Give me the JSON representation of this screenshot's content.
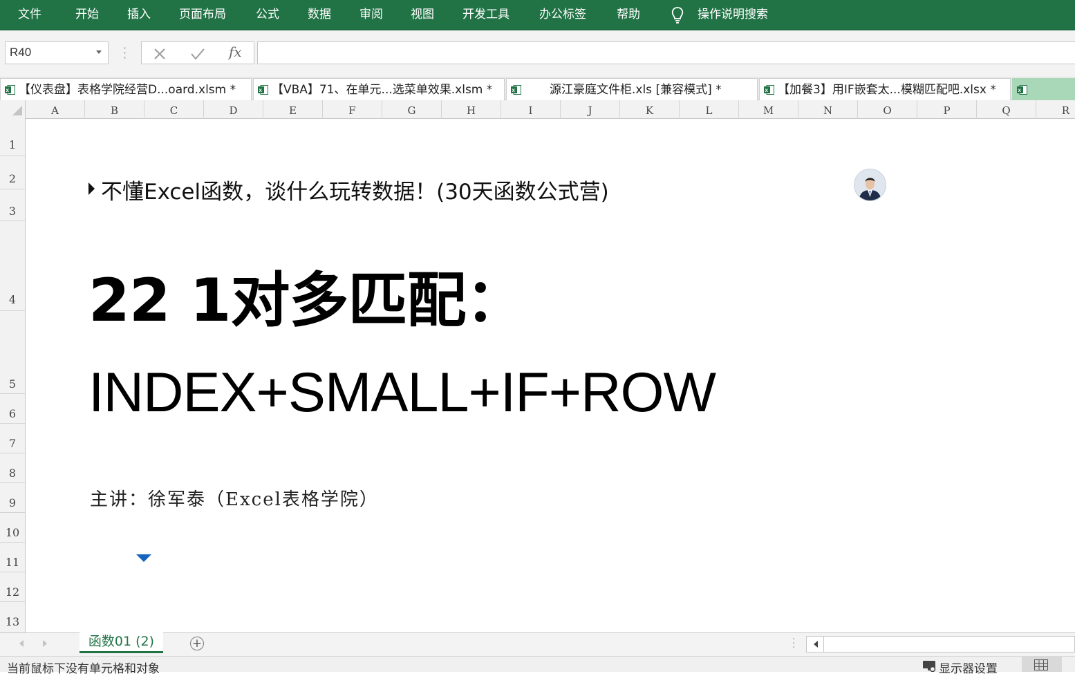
{
  "ribbon": {
    "menu": [
      "文件",
      "开始",
      "插入",
      "页面布局",
      "公式",
      "数据",
      "审阅",
      "视图",
      "开发工具",
      "办公标签",
      "帮助"
    ],
    "search_label": "操作说明搜索"
  },
  "formula_bar": {
    "name_box": "R40",
    "cancel_icon": "cancel-icon",
    "enter_icon": "checkmark-icon",
    "fx_label": "fx",
    "formula_value": ""
  },
  "workbook_tabs": [
    {
      "label": "【仪表盘】表格学院经营D...oard.xlsm *"
    },
    {
      "label": "【VBA】71、在单元...选菜单效果.xlsm *"
    },
    {
      "label": "源江豪庭文件柜.xls  [兼容模式] *"
    },
    {
      "label": "【加餐3】用IF嵌套太...模糊匹配吧.xlsx *"
    }
  ],
  "columns": [
    "A",
    "B",
    "C",
    "D",
    "E",
    "F",
    "G",
    "H",
    "I",
    "J",
    "K",
    "L",
    "M",
    "N",
    "O",
    "P",
    "Q",
    "R"
  ],
  "rows": [
    "1",
    "2",
    "3",
    "4",
    "5",
    "6",
    "7",
    "8",
    "9",
    "10",
    "11",
    "12",
    "13"
  ],
  "content": {
    "subtitle": "不懂Excel函数，谈什么玩转数据！(30天函数公式营)",
    "title": "22 1对多匹配：",
    "formula": "INDEX+SMALL+IF+ROW",
    "presenter": "主讲：徐军泰（Excel表格学院）"
  },
  "sheet_tabs": {
    "active": "函数01 (2)",
    "add_label": "+"
  },
  "status_bar": {
    "message": "当前鼠标下没有单元格和对象",
    "display_settings": "显示器设置"
  },
  "colors": {
    "accent": "#217346",
    "caret_blue": "#1565c0"
  }
}
